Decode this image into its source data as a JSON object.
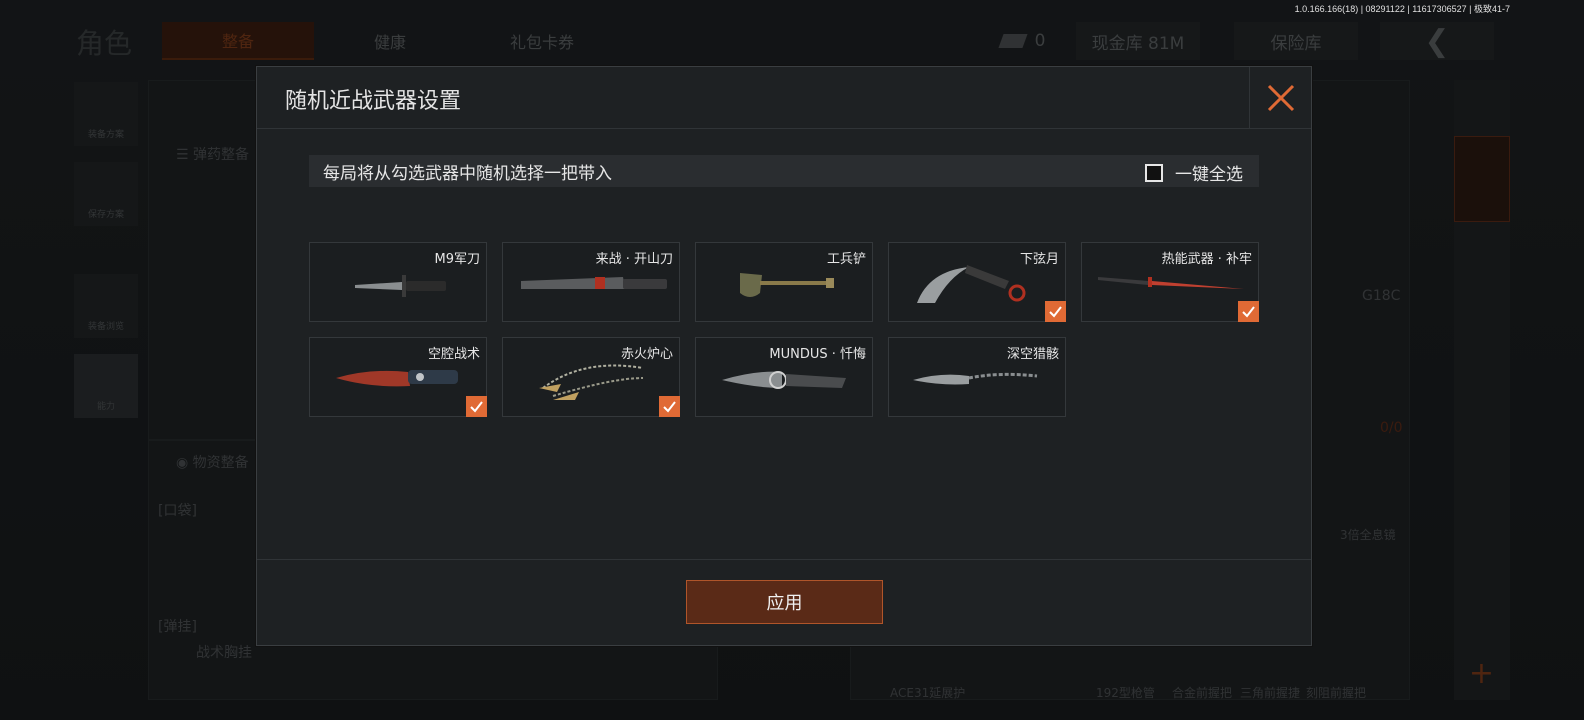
{
  "version_text": "1.0.166.166(18) | 08291122 | 11617306527 | 极致41-7",
  "background": {
    "page_title": "角色",
    "tabs": [
      "整备",
      "健康",
      "礼包卡券"
    ],
    "currency_value": "0",
    "warehouse_label": "现金库 81M",
    "safe_label": "保险库",
    "side_items": [
      "装备方案",
      "保存方案",
      "装备浏览",
      "能力"
    ],
    "ammo_label": "弹药整备",
    "supplies_label": "物资整备",
    "pocket_label": "[口袋]",
    "vest_label": "[弹挂]",
    "vest_item": "战术胸挂",
    "weapon_right": "G18C",
    "ammo_count": "0/0",
    "scope_label": "3倍全息镜",
    "bottom_labels": [
      "ACE31延展护",
      "192型枪管",
      "合金前握把",
      "三角前握捷",
      "刻阻前握把"
    ]
  },
  "modal": {
    "title": "随机近战武器设置",
    "info_text": "每局将从勾选武器中随机选择一把带入",
    "select_all_label": "一键全选",
    "select_all_checked": false,
    "apply_label": "应用",
    "accent_color": "#e06a35"
  },
  "weapons": [
    {
      "name": "M9军刀",
      "checked": false,
      "icon": "bayonet-icon"
    },
    {
      "name": "来战 · 开山刀",
      "checked": false,
      "icon": "machete-icon"
    },
    {
      "name": "工兵铲",
      "checked": false,
      "icon": "shovel-icon"
    },
    {
      "name": "下弦月",
      "checked": true,
      "icon": "karambit-icon"
    },
    {
      "name": "热能武器 · 补牢",
      "checked": true,
      "icon": "katana-icon"
    },
    {
      "name": "空腔战术",
      "checked": true,
      "icon": "tactical-knife-icon"
    },
    {
      "name": "赤火炉心",
      "checked": true,
      "icon": "chain-kunai-icon"
    },
    {
      "name": "MUNDUS · 忏悔",
      "checked": false,
      "icon": "ornate-knife-icon"
    },
    {
      "name": "深空猎骸",
      "checked": false,
      "icon": "chain-blade-icon"
    }
  ]
}
